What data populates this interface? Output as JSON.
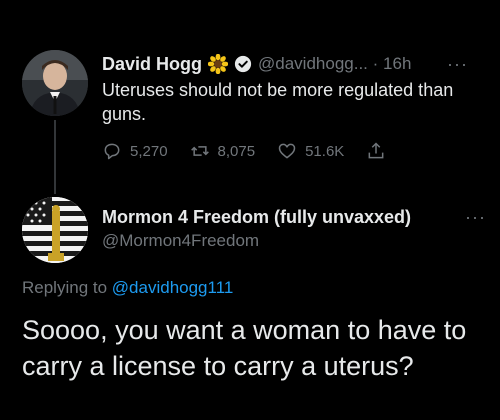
{
  "reply_to_tweet": {
    "author_name": "David Hogg",
    "handle": "@davidhogg...",
    "separator": "·",
    "time": "16h",
    "more": "···",
    "text": "Uteruses should not be more regulated than guns.",
    "stats": {
      "replies": "5,270",
      "retweets": "8,075",
      "likes": "51.6K"
    },
    "icons": [
      "sunflower-icon",
      "verified-icon",
      "reply-icon",
      "retweet-icon",
      "like-icon",
      "share-icon"
    ]
  },
  "main_tweet": {
    "author_name": "Mormon 4 Freedom (fully unvaxxed)",
    "handle": "@Mormon4Freedom",
    "more": "···",
    "replying_prefix": "Replying to",
    "replying_mention": "@davidhogg111",
    "text": "Soooo, you want a woman to have to carry a license to carry a uterus?"
  },
  "colors": {
    "background": "#000000",
    "text": "#e7e9ea",
    "secondary": "#71767b",
    "accent": "#1d9bf0",
    "verified": "#1d9bf0"
  }
}
